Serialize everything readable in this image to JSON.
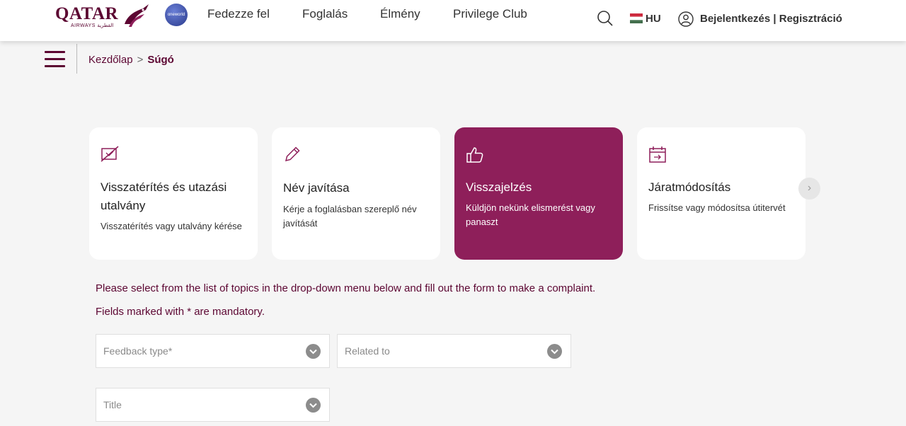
{
  "header": {
    "logo_word": "QATAR",
    "logo_sub": "AIRWAYS القطرية",
    "oneworld_label": "oneworld",
    "nav": [
      "Fedezze fel",
      "Foglalás",
      "Élmény",
      "Privilege Club"
    ],
    "language": "HU",
    "login": "Bejelentkezés | Regisztráció"
  },
  "breadcrumb": {
    "home": "Kezdőlap",
    "separator": ">",
    "current": "Súgó"
  },
  "cards": [
    {
      "title": "Visszatérítés és utazási utalvány",
      "desc": "Visszatérítés vagy utalvány kérése",
      "icon": "refund-icon",
      "active": false
    },
    {
      "title": "Név javítása",
      "desc": "Kérje a foglalásban szereplő név javítását",
      "icon": "pencil-icon",
      "active": false
    },
    {
      "title": "Visszajelzés",
      "desc": "Küldjön nekünk elismerést vagy panaszt",
      "icon": "thumbs-up-icon",
      "active": true
    },
    {
      "title": "Járatmódosítás",
      "desc": "Frissítse vagy módosítsa útitervét",
      "icon": "calendar-icon",
      "active": false
    }
  ],
  "next_label": "›",
  "instructions": {
    "line1": "Please select from the list of topics in the drop-down menu below and fill out the form to make a complaint.",
    "line2": "Fields marked with * are mandatory."
  },
  "form": {
    "feedback_type": "Feedback type*",
    "related_to": "Related to",
    "title": "Title"
  },
  "colors": {
    "brand": "#5c0632",
    "active_card": "#8e1f5a"
  }
}
